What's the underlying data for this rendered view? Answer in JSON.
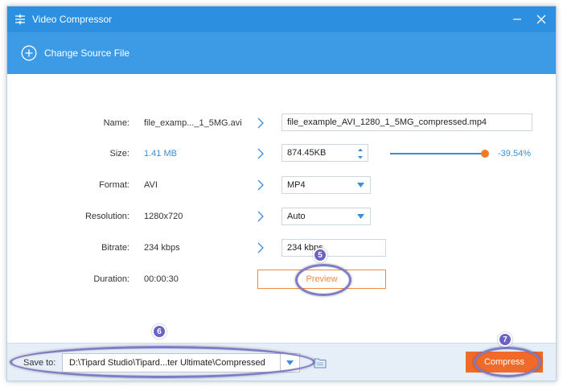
{
  "window": {
    "title": "Video Compressor"
  },
  "toolbar": {
    "change_source_label": "Change Source File"
  },
  "fields": {
    "name": {
      "label": "Name:",
      "source": "file_examp..._1_5MG.avi",
      "output": "file_example_AVI_1280_1_5MG_compressed.mp4"
    },
    "size": {
      "label": "Size:",
      "source": "1.41 MB",
      "output": "874.45KB",
      "percent": "-39.54%",
      "slider_fraction": 0.92
    },
    "format": {
      "label": "Format:",
      "source": "AVI",
      "output": "MP4"
    },
    "resolution": {
      "label": "Resolution:",
      "source": "1280x720",
      "output": "Auto"
    },
    "bitrate": {
      "label": "Bitrate:",
      "source": "234 kbps",
      "output": "234 kbps"
    },
    "duration": {
      "label": "Duration:",
      "source": "00:00:30"
    }
  },
  "preview_label": "Preview",
  "bottom": {
    "save_to_label": "Save to:",
    "save_path": "D:\\Tipard Studio\\Tipard...ter Ultimate\\Compressed",
    "compress_label": "Compress"
  },
  "annotations": {
    "step_preview": "5",
    "step_save": "6",
    "step_compress": "7"
  },
  "colors": {
    "titlebar": "#2d8fe0",
    "toolbar": "#3d9be6",
    "accent": "#3a8fd6",
    "orange": "#f06a2a",
    "annotation": "#6a62c6"
  }
}
